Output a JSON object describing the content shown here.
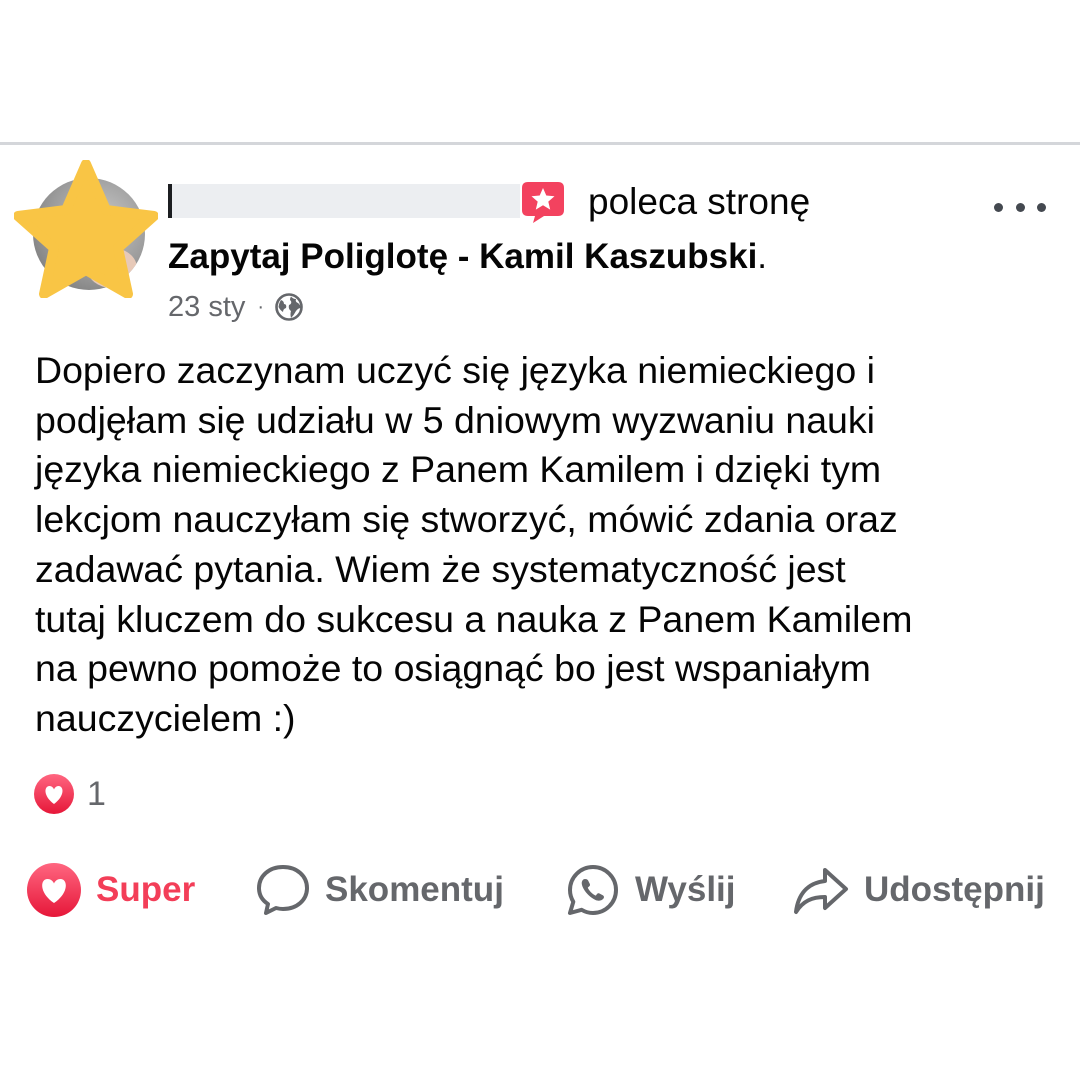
{
  "post": {
    "recommends_text": "poleca stronę",
    "page_name": "Zapytaj Poliglotę - Kamil Kaszubski",
    "page_name_suffix": ".",
    "date": "23 sty",
    "separator": "·",
    "audience_icon": "globe-icon",
    "author_name_redacted": true,
    "body": "Dopiero zaczynam uczyć się języka niemieckiego i\npodjęłam się udziału w 5 dniowym wyzwaniu nauki\njęzyka niemieckiego z Panem Kamilem i dzięki tym\nlekcjom nauczyłam się stworzyć, mówić zdania oraz\nzadawać pytania. Wiem że systematyczność jest\ntutaj kluczem do sukcesu a nauka z Panem Kamilem\nna pewno pomoże to osiągnąć bo jest wspaniałym\nnauczycielem :)"
  },
  "reactions": {
    "icon": "love-reaction-icon",
    "count": "1"
  },
  "actions": [
    {
      "label": "Super",
      "icon": "heart-icon",
      "active": true
    },
    {
      "label": "Skomentuj",
      "icon": "comment-icon"
    },
    {
      "label": "Wyślij",
      "icon": "whatsapp-icon"
    },
    {
      "label": "Udostępnij",
      "icon": "share-icon"
    }
  ],
  "colors": {
    "love_red": "#f33e58",
    "recommend_red": "#f3425f",
    "secondary_text": "#65676b",
    "primary_text": "#050505",
    "star_yellow": "#f9c545",
    "divider": "#d4d6da"
  }
}
